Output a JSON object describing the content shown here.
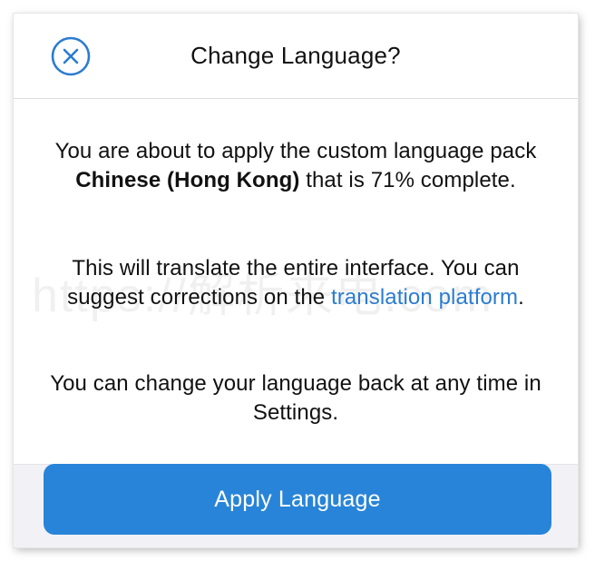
{
  "dialog": {
    "title": "Change Language?",
    "close_icon": "close-circle-icon"
  },
  "message": {
    "p1_before": "You are about to apply the custom language pack ",
    "p1_language": "Chinese (Hong Kong)",
    "p1_after": " that is 71% complete.",
    "p2_before": "This will translate the entire interface. You can suggest corrections on the ",
    "p2_link": "translation platform",
    "p2_after": ".",
    "p3": "You can change your language back at any time in Settings."
  },
  "actions": {
    "apply_label": "Apply Language"
  },
  "watermark": "https://解析来电.com",
  "colors": {
    "accent": "#2884d8",
    "link": "#2b7cd0",
    "footer_bg": "#f2f2f6"
  }
}
